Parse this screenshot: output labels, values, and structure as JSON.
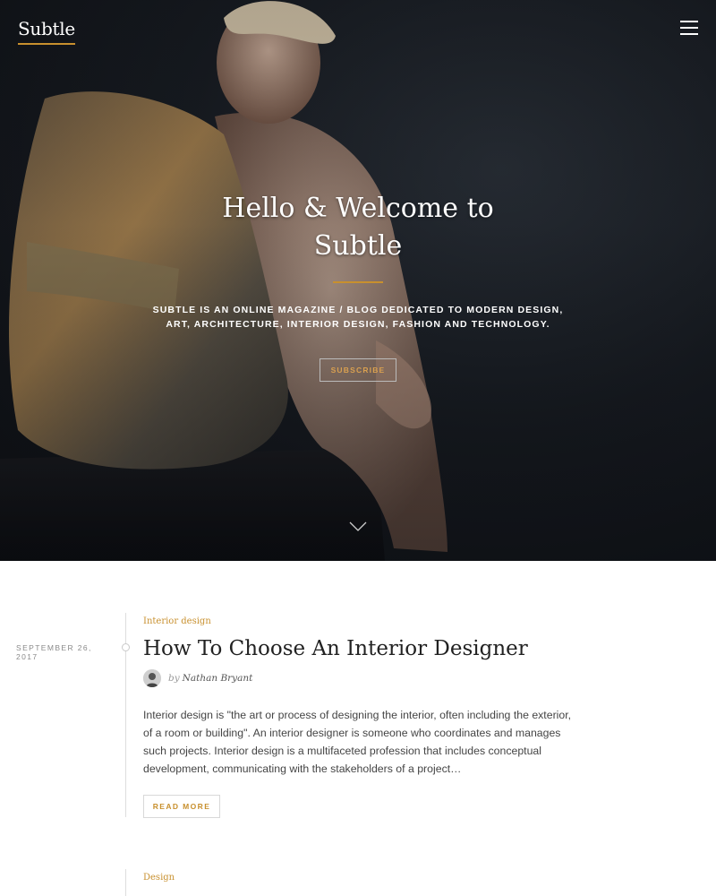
{
  "brand": {
    "logo": "Subtle",
    "accent_color": "#c8902e"
  },
  "header": {
    "menu_icon": "hamburger-menu-icon"
  },
  "hero": {
    "title_line1": "Hello & Welcome to",
    "title_line2": "Subtle",
    "description": "Subtle is an online magazine / blog dedicated to modern design, art, architecture, interior design, fashion and technology.",
    "subscribe_label": "SUBSCRIBE",
    "scroll_icon": "chevron-down-icon"
  },
  "posts": [
    {
      "category": "Interior design",
      "date": "September 26, 2017",
      "title": "How To Choose An Interior Designer",
      "author_prefix": "by",
      "author": "Nathan Bryant",
      "excerpt": "Interior design is \"the art or process of designing the interior, often including the exterior, of a room or building\". An interior designer is someone who coordinates and manages such projects. Interior design is a multifaceted profession that includes conceptual development, communicating with the stakeholders of a project…",
      "read_more_label": "READ MORE"
    },
    {
      "category": "Design"
    }
  ]
}
